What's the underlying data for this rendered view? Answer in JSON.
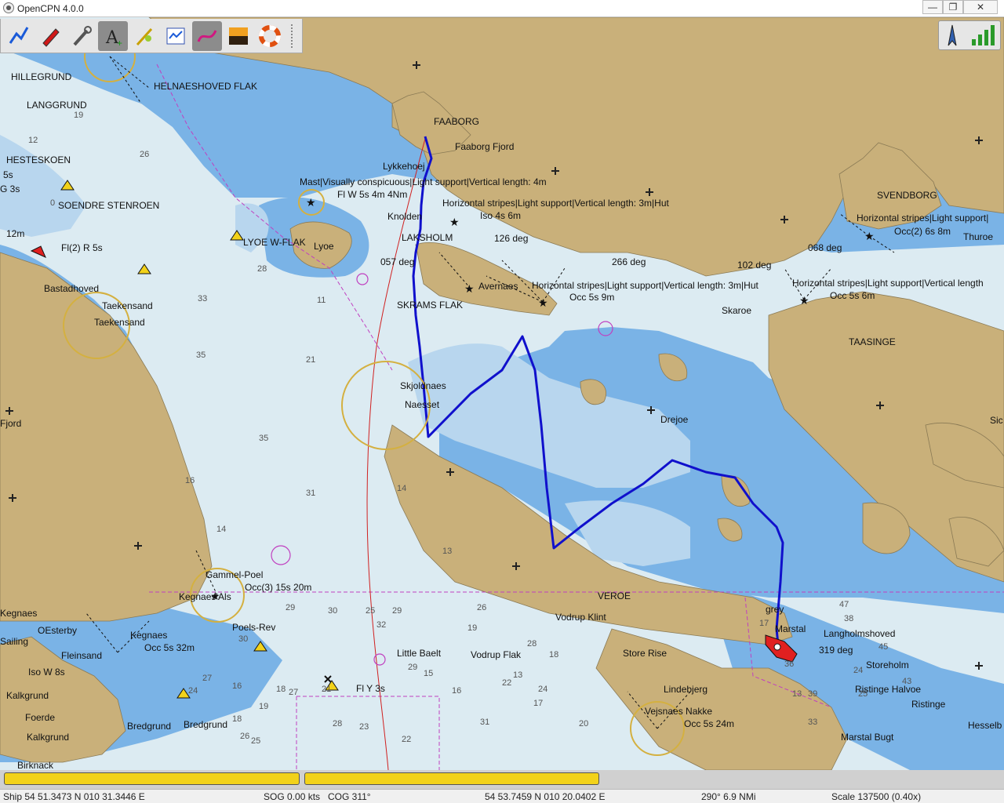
{
  "window": {
    "title": "OpenCPN 4.0.0",
    "min_glyph": "—",
    "max_glyph": "❐",
    "close_glyph": "✕"
  },
  "toolbar": {
    "tools": [
      {
        "name": "route-icon"
      },
      {
        "name": "ship-icon"
      },
      {
        "name": "tools-icon"
      },
      {
        "name": "text-icon",
        "active": true
      },
      {
        "name": "waypoint-icon"
      },
      {
        "name": "route-manager-icon"
      },
      {
        "name": "track-icon",
        "active": true
      },
      {
        "name": "color-scheme-icon"
      },
      {
        "name": "lifebuoy-icon"
      }
    ]
  },
  "colors": {
    "land": "#c9b07a",
    "deep": "#dcebf2",
    "shallow": "#7ab3e6",
    "medium": "#b8d6ee",
    "route": "#1010cc",
    "piano": "#f2d21a"
  },
  "map_labels": [
    {
      "text": "HILLEGRUND"
    },
    {
      "text": "HELNAESHOVED FLAK"
    },
    {
      "text": "LANGGRUND"
    },
    {
      "text": "HESTESKOEN"
    },
    {
      "text": "5s"
    },
    {
      "text": "G 3s"
    },
    {
      "text": "SOENDRE STENROEN"
    },
    {
      "text": "12m"
    },
    {
      "text": "Fl(2) R 5s"
    },
    {
      "text": "LYOE W-FLAK"
    },
    {
      "text": "Lyoe"
    },
    {
      "text": "FAABORG"
    },
    {
      "text": "Faaborg Fjord"
    },
    {
      "text": "Lykkehoej"
    },
    {
      "text": "Mast|Visually conspicuous|Light support|Vertical length: 4m"
    },
    {
      "text": "Fl W 5s 4m 4Nm"
    },
    {
      "text": "Horizontal stripes|Light support|Vertical length: 3m|Hut"
    },
    {
      "text": "Iso 4s 6m"
    },
    {
      "text": "Knolden"
    },
    {
      "text": "LAKSHOLM"
    },
    {
      "text": "126 deg"
    },
    {
      "text": "057 deg"
    },
    {
      "text": "266 deg"
    },
    {
      "text": "102 deg"
    },
    {
      "text": "SVENDBORG"
    },
    {
      "text": "Horizontal stripes|Light support|"
    },
    {
      "text": "Occ(2) 6s 8m"
    },
    {
      "text": "Thuroe"
    },
    {
      "text": "068 deg"
    },
    {
      "text": "Horizontal stripes|Light support|Vertical length"
    },
    {
      "text": "Occ 5s 6m"
    },
    {
      "text": "Bastadhoved"
    },
    {
      "text": "Taekensand"
    },
    {
      "text": "Taekensand"
    },
    {
      "text": "SKRAMS FLAK"
    },
    {
      "text": "Avernaes"
    },
    {
      "text": "Horizontal stripes|Light support|Vertical length: 3m|Hut"
    },
    {
      "text": "Occ 5s 9m"
    },
    {
      "text": "Skaroe"
    },
    {
      "text": "TAASINGE"
    },
    {
      "text": "Skjoldnaes"
    },
    {
      "text": "Naesset"
    },
    {
      "text": "Drejoe"
    },
    {
      "text": "Sic"
    },
    {
      "text": "Fjord"
    },
    {
      "text": "Gammel-Poel"
    },
    {
      "text": "Occ(3) 15s 20m"
    },
    {
      "text": "Kegnaes Als"
    },
    {
      "text": "Poels-Rev"
    },
    {
      "text": "Kegnaes"
    },
    {
      "text": "OEsterby"
    },
    {
      "text": "Kegnaes"
    },
    {
      "text": "Occ 5s 32m"
    },
    {
      "text": "Fleinsand"
    },
    {
      "text": "Iso W 8s"
    },
    {
      "text": "Kalkgrund"
    },
    {
      "text": "Foerde"
    },
    {
      "text": "Kalkgrund"
    },
    {
      "text": "Birknack"
    },
    {
      "text": "Bredgrund"
    },
    {
      "text": "Bredgrund"
    },
    {
      "text": "Little Baelt"
    },
    {
      "text": "Vodrup Flak"
    },
    {
      "text": "Fl Y 3s"
    },
    {
      "text": "Vodrup Klint"
    },
    {
      "text": "Store Rise"
    },
    {
      "text": "Lindebjerg"
    },
    {
      "text": "Vejsnaes Nakke"
    },
    {
      "text": "Occ 5s 24m"
    },
    {
      "text": "grey"
    },
    {
      "text": "Marstal"
    },
    {
      "text": "Langholmshoved"
    },
    {
      "text": "319 deg"
    },
    {
      "text": "Storeholm"
    },
    {
      "text": "Ristinge Halvoe"
    },
    {
      "text": "Ristinge"
    },
    {
      "text": "Marstal Bugt"
    },
    {
      "text": "Hesselb"
    },
    {
      "text": "VEROE"
    },
    {
      "text": "Sailing"
    }
  ],
  "depths": [
    "19",
    "26",
    "12",
    "0",
    "28",
    "33",
    "21",
    "35",
    "35",
    "31",
    "16",
    "14",
    "32",
    "30",
    "25",
    "11",
    "14",
    "13",
    "29",
    "30",
    "29",
    "26",
    "29",
    "31",
    "16",
    "22",
    "24",
    "28",
    "19",
    "18",
    "27",
    "21",
    "28",
    "26",
    "23",
    "22",
    "15",
    "17",
    "20",
    "13",
    "18",
    "16",
    "19",
    "24",
    "18",
    "25",
    "27",
    "36",
    "17",
    "13",
    "38",
    "33",
    "47",
    "24",
    "45",
    "43",
    "39",
    "25"
  ],
  "status": {
    "ship": "Ship 54 51.3473 N   010 31.3446 E",
    "sog": "SOG 0.00 kts",
    "cog": "COG 311°",
    "cursor": "54 53.7459 N   010 20.0402 E",
    "bearing": "290°  6.9 NMi",
    "scale": "Scale 137500 (0.40x)"
  }
}
